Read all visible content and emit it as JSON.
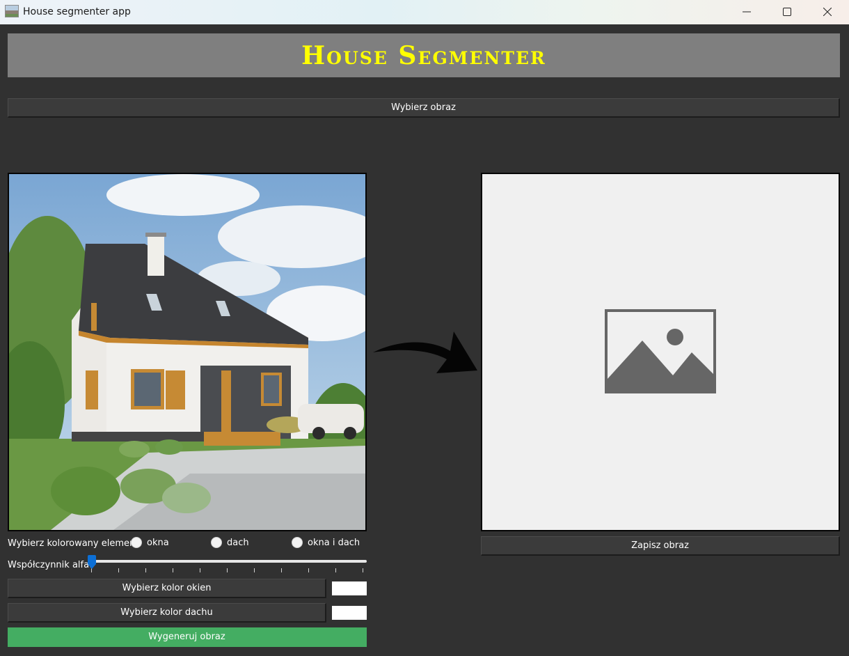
{
  "window": {
    "title": "House segmenter app"
  },
  "header": {
    "title": "House Segmenter"
  },
  "buttons": {
    "choose_image": "Wybierz obraz",
    "save_image": "Zapisz obraz",
    "window_color": "Wybierz kolor okien",
    "roof_color": "Wybierz kolor dachu",
    "generate": "Wygeneruj obraz"
  },
  "segment_choice": {
    "label": "Wybierz kolorowany element:",
    "options": [
      "okna",
      "dach",
      "okna i dach"
    ],
    "selected": null
  },
  "alpha": {
    "label": "Współczynnik alfa:",
    "value": 0
  },
  "swatches": {
    "window_color": "#ffffff",
    "roof_color": "#ffffff"
  },
  "colors": {
    "accent_green": "#44ad62",
    "header_text": "#ffff00",
    "slider_handle": "#0c6fd6"
  },
  "icons": [
    "minimize-icon",
    "maximize-icon",
    "close-icon",
    "arrow-right-icon",
    "image-placeholder-icon"
  ]
}
